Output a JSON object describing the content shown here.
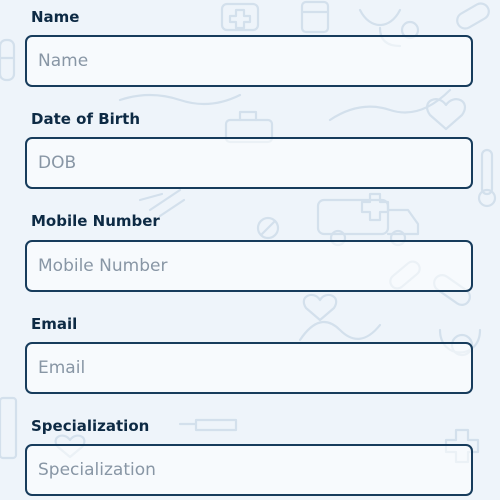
{
  "form": {
    "fields": [
      {
        "label": "Name",
        "value": "",
        "placeholder": "Name"
      },
      {
        "label": "Date of Birth",
        "value": "",
        "placeholder": "DOB"
      },
      {
        "label": "Mobile Number",
        "value": "",
        "placeholder": "Mobile Number"
      },
      {
        "label": "Email",
        "value": "",
        "placeholder": "Email"
      },
      {
        "label": "Specialization",
        "value": "",
        "placeholder": "Specialization"
      }
    ]
  },
  "colors": {
    "background": "#eef4fa",
    "label_text": "#0d2a44",
    "field_border": "#173c5c",
    "placeholder_text": "#8896a5",
    "pattern_stroke": "#d3e0ec"
  },
  "background_pattern": {
    "icons": [
      "cross-icon",
      "ambulance-icon",
      "medicine-bottle-icon",
      "pill-icon",
      "heart-icon",
      "stethoscope-icon",
      "syringe-icon",
      "bandage-icon",
      "medical-cart-icon",
      "thermometer-icon"
    ]
  }
}
